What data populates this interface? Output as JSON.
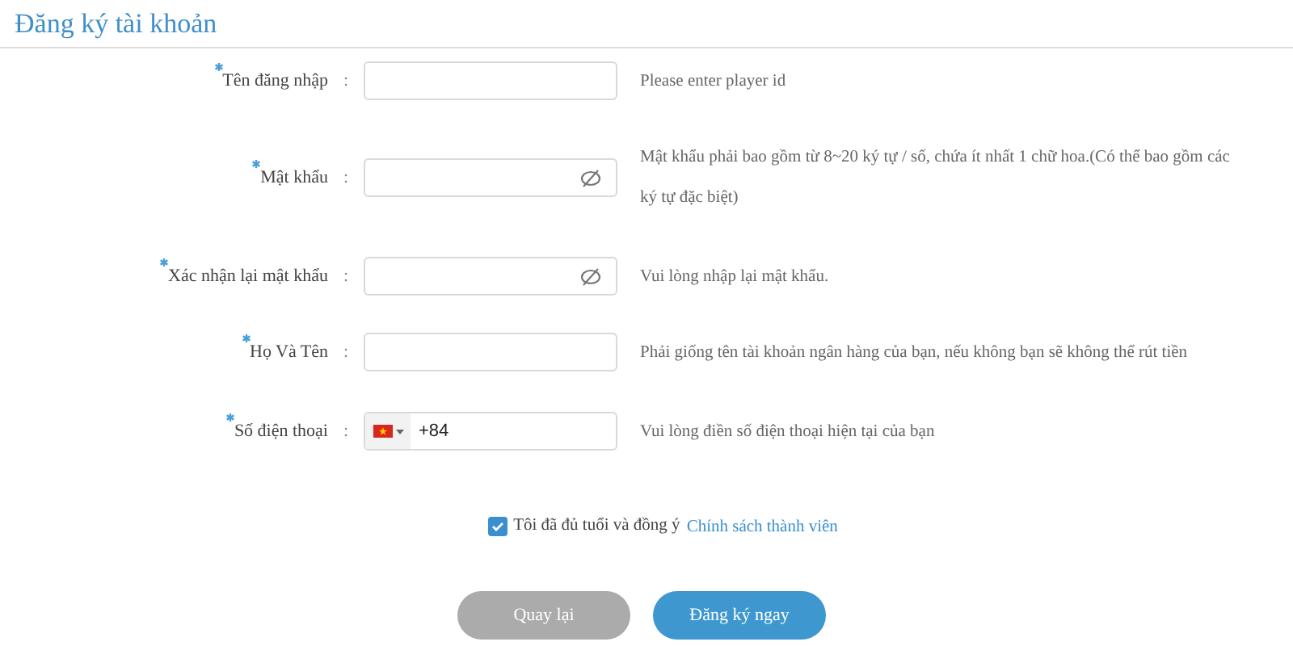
{
  "title": "Đăng ký tài khoản",
  "fields": [
    {
      "label": "Tên đăng nhập",
      "separator": ":",
      "kind": "text",
      "required": true,
      "hint": "Please enter player id"
    },
    {
      "label": "Mật khẩu",
      "separator": ":",
      "kind": "password",
      "required": true,
      "hint": "Mật khẩu phải bao gồm từ 8~20 ký tự / số, chứa ít nhất 1 chữ hoa.(Có thể bao gồm các ký tự đặc biệt)"
    },
    {
      "label": "Xác nhận lại mật khẩu",
      "separator": ":",
      "kind": "password",
      "required": true,
      "hint": "Vui lòng nhập lại mật khẩu."
    },
    {
      "label": "Họ Và Tên",
      "separator": ":",
      "kind": "text",
      "required": true,
      "hint": "Phải giống tên tài khoản ngân hàng của bạn, nếu không bạn sẽ không thể rút tiền"
    },
    {
      "label": "Số điện thoại",
      "separator": ":",
      "kind": "phone",
      "required": true,
      "value": "+84",
      "hint": "Vui lòng điền số điện thoại hiện tại của bạn"
    }
  ],
  "agreement": {
    "checked": true,
    "text": "Tôi đã đủ tuổi và đồng ý",
    "link": "Chính sách thành viên"
  },
  "buttons": [
    {
      "label": "Quay lại",
      "kind": "secondary"
    },
    {
      "label": "Đăng ký ngay",
      "kind": "primary"
    }
  ]
}
